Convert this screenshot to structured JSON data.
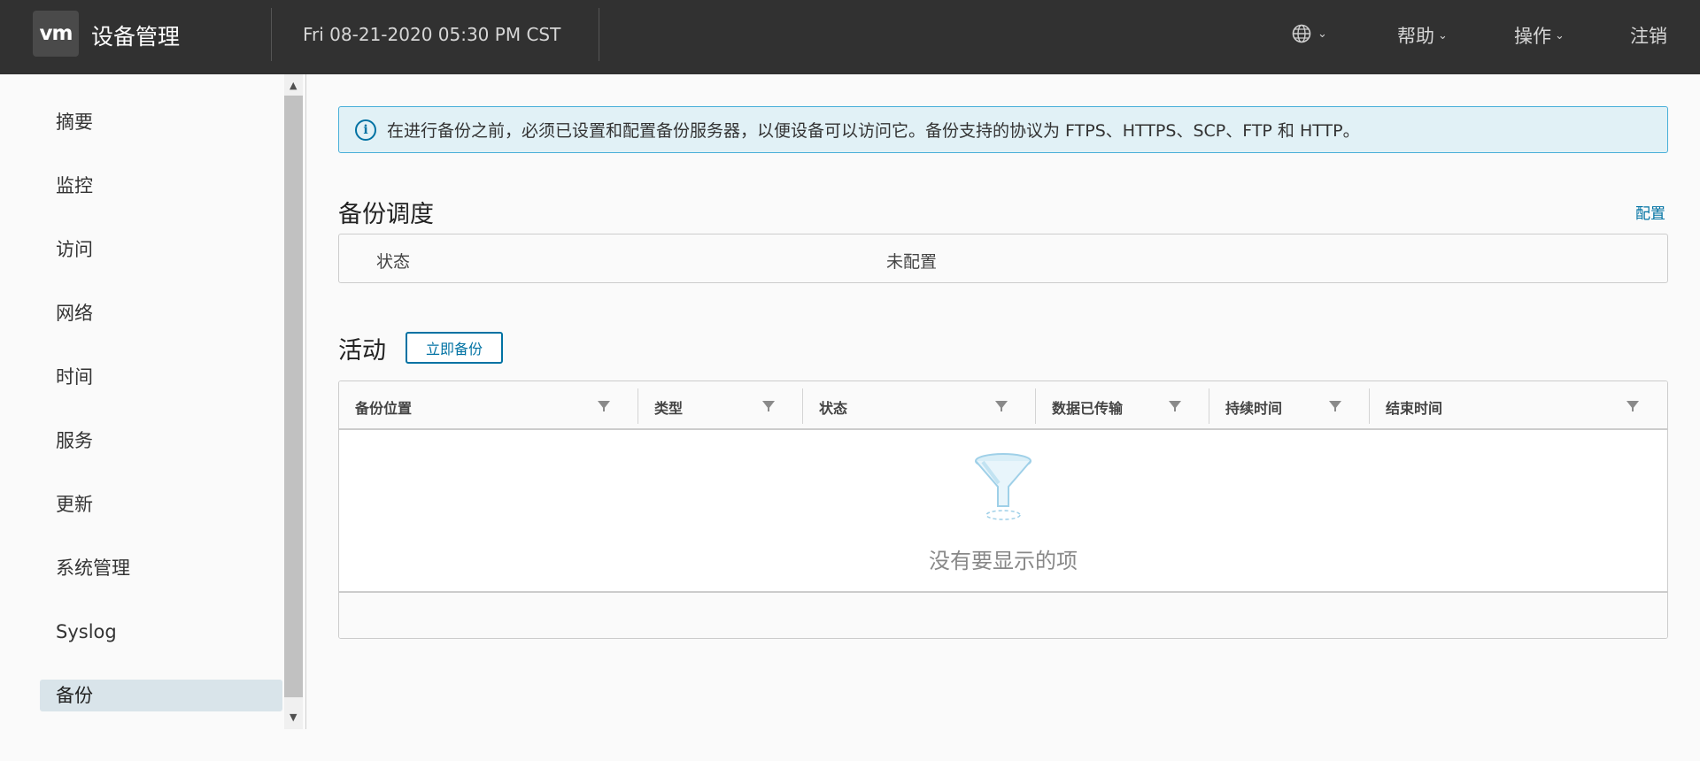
{
  "header": {
    "logo_text": "vm",
    "title": "设备管理",
    "datetime": "Fri 08-21-2020 05:30 PM CST",
    "globe_icon": "globe-icon",
    "nav": [
      {
        "label": "帮助"
      },
      {
        "label": "操作"
      },
      {
        "label": "注销"
      }
    ]
  },
  "sidebar": {
    "items": [
      {
        "label": "摘要"
      },
      {
        "label": "监控"
      },
      {
        "label": "访问"
      },
      {
        "label": "网络"
      },
      {
        "label": "时间"
      },
      {
        "label": "服务"
      },
      {
        "label": "更新"
      },
      {
        "label": "系统管理"
      },
      {
        "label": "Syslog"
      },
      {
        "label": "备份",
        "active": true
      }
    ]
  },
  "alert": {
    "icon": "info-icon",
    "text": "在进行备份之前，必须已设置和配置备份服务器，以便设备可以访问它。备份支持的协议为 FTPS、HTTPS、SCP、FTP 和 HTTP。"
  },
  "schedule": {
    "title": "备份调度",
    "configure_link": "配置",
    "status_label": "状态",
    "status_value": "未配置"
  },
  "activity": {
    "title": "活动",
    "backup_now_button": "立即备份",
    "columns": [
      "备份位置",
      "类型",
      "状态",
      "数据已传输",
      "持续时间",
      "结束时间"
    ],
    "empty_text": "没有要显示的项"
  },
  "colors": {
    "header_bg": "#313131",
    "accent": "#0072a3",
    "alert_bg": "#e1f1f6",
    "alert_border": "#49afd9",
    "active_nav_bg": "#d9e4ea"
  }
}
